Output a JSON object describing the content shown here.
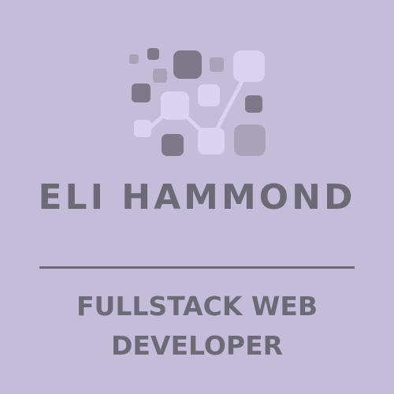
{
  "colors": {
    "background": "#c4bdd9",
    "text": "#6d6a78",
    "divider": "#6d6a78",
    "square_dark": "#7d7989",
    "square_mid": "#a9a3b9",
    "square_light": "#dad4ee",
    "connector": "#dad4ee"
  },
  "logo": {
    "icon": "network-squares-logo-icon"
  },
  "card": {
    "name": "ELI HAMMOND",
    "role_line_1": "FULLSTACK WEB",
    "role_line_2": "DEVELOPER"
  }
}
